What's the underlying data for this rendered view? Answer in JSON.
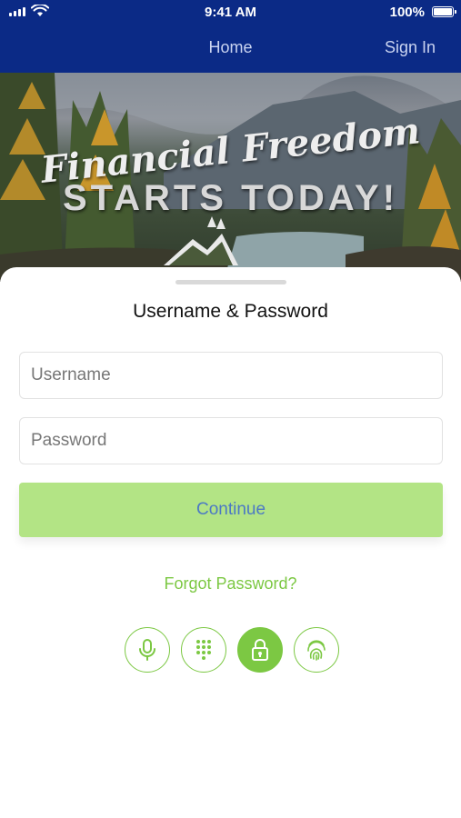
{
  "status_bar": {
    "time": "9:41 AM",
    "battery": "100%"
  },
  "nav": {
    "title": "Home",
    "sign_in": "Sign In"
  },
  "hero": {
    "line1": "Financial Freedom",
    "line2": "STARTS TODAY!"
  },
  "login": {
    "title": "Username & Password",
    "username_placeholder": "Username",
    "password_placeholder": "Password",
    "continue_label": "Continue",
    "forgot_label": "Forgot Password?"
  },
  "auth_methods": [
    {
      "icon": "microphone-icon",
      "active": false
    },
    {
      "icon": "keypad-icon",
      "active": false
    },
    {
      "icon": "lock-icon",
      "active": true
    },
    {
      "icon": "fingerprint-icon",
      "active": false
    }
  ],
  "colors": {
    "nav_bg": "#0b2a86",
    "accent_green": "#7cc843",
    "continue_bg": "#b3e485",
    "continue_text": "#4c79c4"
  }
}
